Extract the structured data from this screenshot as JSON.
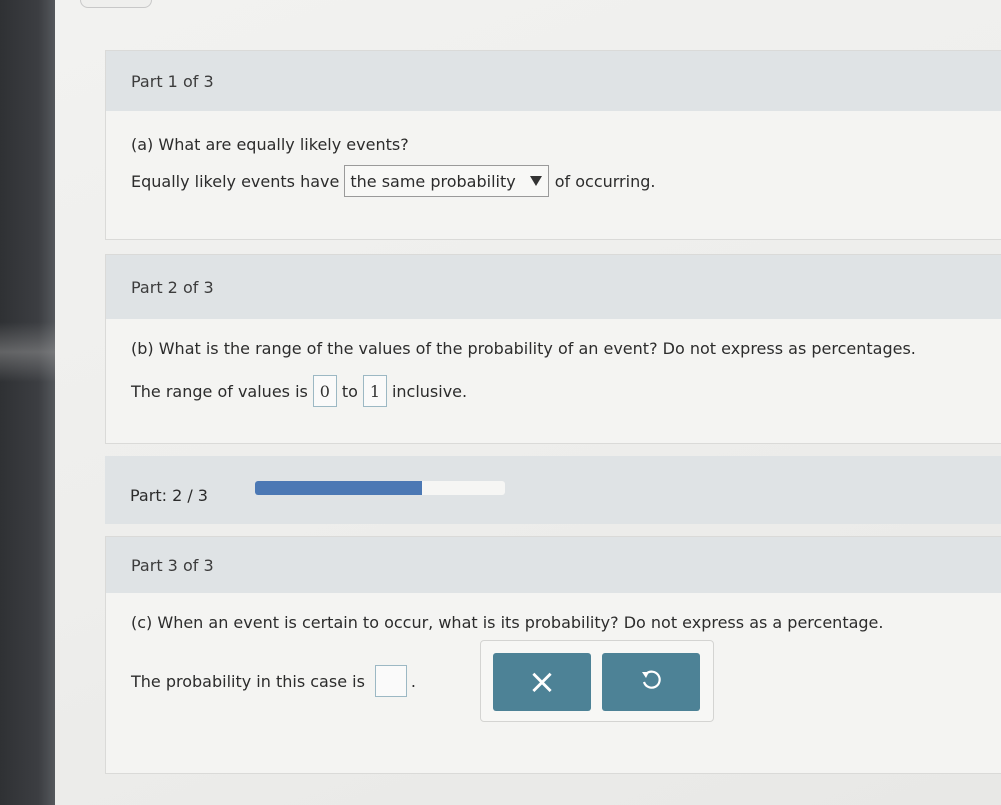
{
  "part1": {
    "header": "Part 1 of 3",
    "question": "(a) What are equally likely events?",
    "answer_prefix": "Equally likely events have",
    "dropdown_value": "the same probability",
    "answer_suffix": "of occurring."
  },
  "part2": {
    "header": "Part 2 of 3",
    "question": "(b) What is the range of the values of the probability of an event? Do not express as percentages.",
    "answer_prefix": "The range of values is",
    "low_value": "0",
    "connector": "to",
    "high_value": "1",
    "answer_suffix": "inclusive."
  },
  "progress": {
    "label": "Part: 2 / 3",
    "current": 2,
    "total": 3
  },
  "part3": {
    "header": "Part 3 of 3",
    "question": "(c) When an event is certain to occur, what is its probability? Do not express as a percentage.",
    "answer_prefix": "The probability in this case is",
    "answer_value": "",
    "answer_suffix": "."
  },
  "buttons": {
    "clear_icon": "×",
    "undo_icon": "↺"
  },
  "colors": {
    "header_bg": "#dfe3e5",
    "progress_fill": "#4b78b4",
    "button_bg": "#4d8296"
  }
}
